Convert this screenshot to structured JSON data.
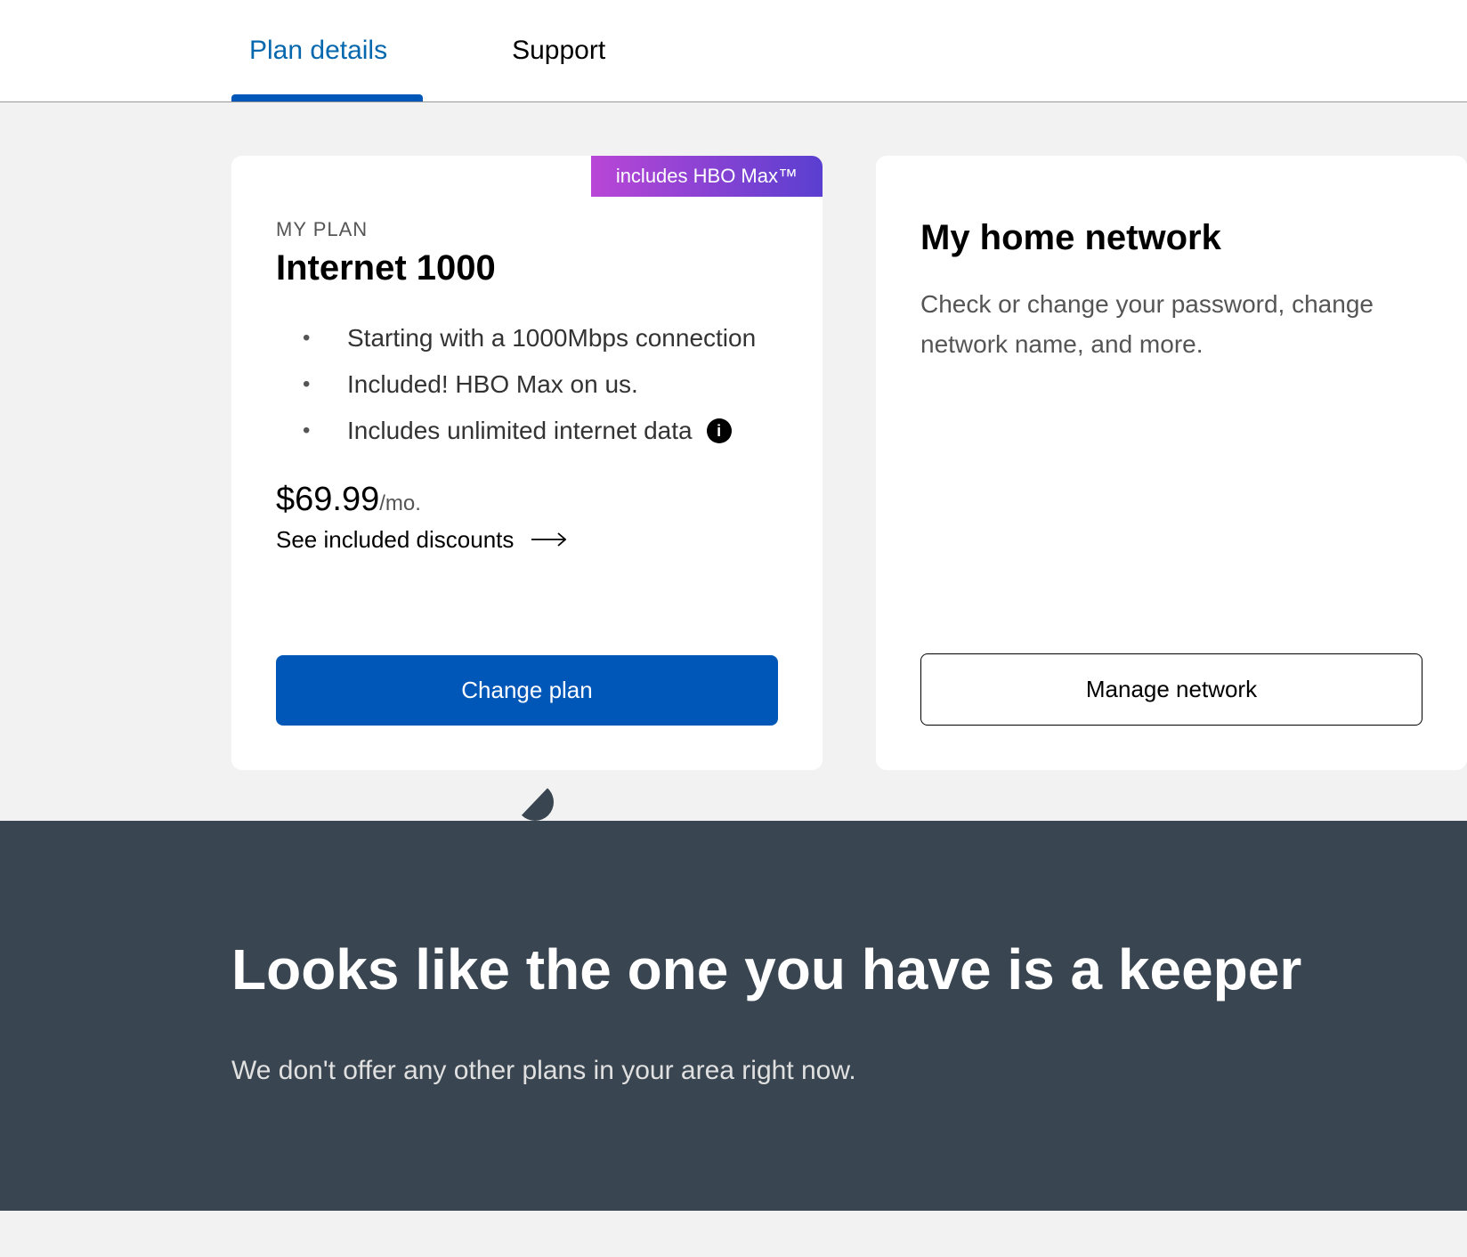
{
  "tabs": {
    "planDetails": "Plan details",
    "support": "Support"
  },
  "planCard": {
    "badge": "includes HBO Max™",
    "label": "MY PLAN",
    "title": "Internet 1000",
    "features": [
      "Starting with a 1000Mbps connection",
      "Included! HBO Max on us.",
      "Includes unlimited internet data"
    ],
    "priceAmount": "$69.99",
    "priceSuffix": "/mo.",
    "discountsLink": "See included discounts",
    "button": "Change plan"
  },
  "networkCard": {
    "title": "My home network",
    "description": "Check or change your password, change network name, and more.",
    "button": "Manage network"
  },
  "bottom": {
    "heading": "Looks like the one you have is a keeper",
    "text": "We don't offer any other plans in your area right now."
  },
  "icons": {
    "info": "i"
  }
}
